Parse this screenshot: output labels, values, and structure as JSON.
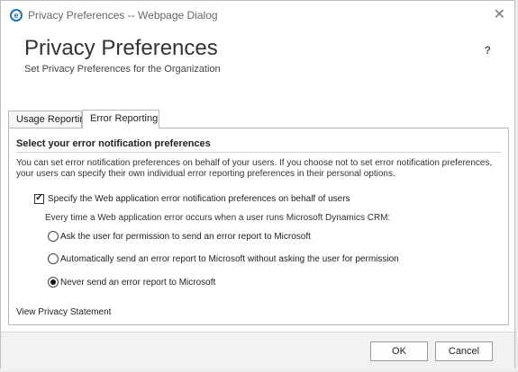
{
  "window": {
    "title": "Privacy Preferences -- Webpage Dialog",
    "close_glyph": "✕",
    "icon_glyph": "e"
  },
  "header": {
    "title": "Privacy Preferences",
    "subtitle": "Set Privacy Preferences for the Organization",
    "help_glyph": "?"
  },
  "tabs": [
    {
      "label": "Usage Reporting",
      "selected": false
    },
    {
      "label": "Error Reporting",
      "selected": true
    }
  ],
  "error_reporting": {
    "heading": "Select your error notification preferences",
    "description": "You can set error notification preferences on behalf of your users. If you choose not to set error notification preferences, your users can specify their own individual error reporting preferences in their personal options.",
    "checkbox": {
      "label": "Specify the Web application error notification preferences on behalf of users",
      "checked": true,
      "check_glyph": "✓"
    },
    "instruction": "Every time a Web application error occurs when a user runs Microsoft Dynamics CRM:",
    "options": [
      {
        "label": "Ask the user for permission to send an error report to Microsoft",
        "selected": false
      },
      {
        "label": "Automatically send an error report to Microsoft without asking the user for permission",
        "selected": false
      },
      {
        "label": "Never send an error report to Microsoft",
        "selected": true
      }
    ]
  },
  "privacy_link": "View Privacy Statement",
  "footer": {
    "ok_label": "OK",
    "cancel_label": "Cancel"
  },
  "icons": {
    "title_icon": "ie-browser-icon",
    "close": "close-icon",
    "help": "help-icon"
  }
}
